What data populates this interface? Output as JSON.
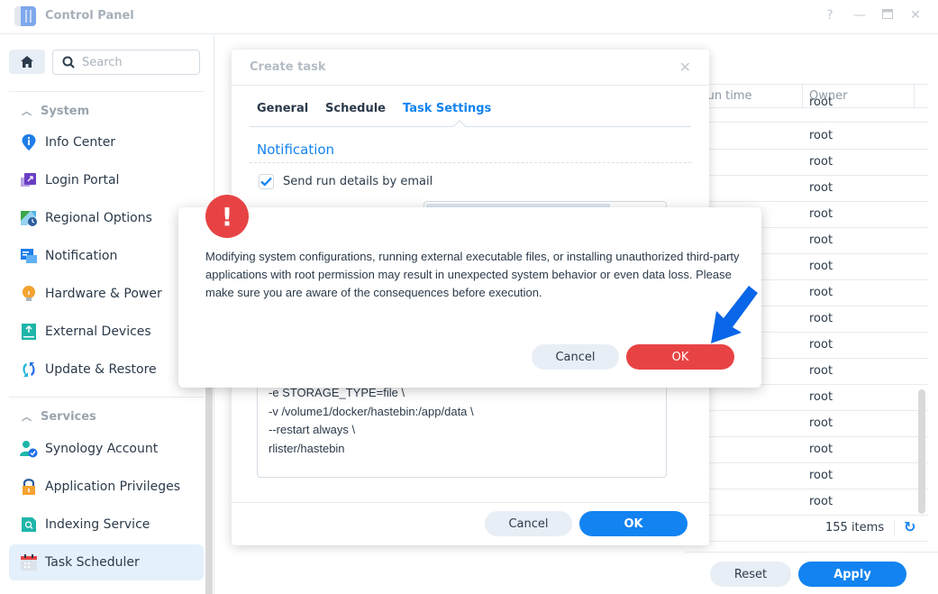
{
  "window": {
    "title": "Control Panel",
    "help_icon": "?",
    "minimize_icon": "—",
    "maximize_icon": "▭",
    "close_icon": "✕"
  },
  "sidebar": {
    "search_placeholder": "Search",
    "sections": [
      {
        "label": "System",
        "items": [
          {
            "label": "Info Center",
            "icon": "info-icon"
          },
          {
            "label": "Login Portal",
            "icon": "login-portal-icon"
          },
          {
            "label": "Regional Options",
            "icon": "regional-options-icon"
          },
          {
            "label": "Notification",
            "icon": "notification-icon"
          },
          {
            "label": "Hardware & Power",
            "icon": "lightbulb-icon"
          },
          {
            "label": "External Devices",
            "icon": "external-device-icon"
          },
          {
            "label": "Update & Restore",
            "icon": "update-icon"
          }
        ]
      },
      {
        "label": "Services",
        "items": [
          {
            "label": "Synology Account",
            "icon": "account-icon"
          },
          {
            "label": "Application Privileges",
            "icon": "lock-icon"
          },
          {
            "label": "Indexing Service",
            "icon": "indexing-icon"
          },
          {
            "label": "Task Scheduler",
            "icon": "calendar-icon",
            "active": true
          }
        ]
      }
    ]
  },
  "grid": {
    "columns": [
      "Next run time",
      "Owner"
    ],
    "visible_header_fragment": "t run time",
    "rows": [
      "root",
      "root",
      "root",
      "root",
      "root",
      "root",
      "root",
      "root",
      "root",
      "root",
      "root",
      "root",
      "root",
      "root",
      "root",
      "root"
    ],
    "items_count": "155 items",
    "refresh_icon": "↻"
  },
  "footer": {
    "reset_label": "Reset",
    "apply_label": "Apply"
  },
  "create_task_dialog": {
    "title": "Create task",
    "close_icon": "✕",
    "tabs": [
      {
        "label": "General"
      },
      {
        "label": "Schedule"
      },
      {
        "label": "Task Settings",
        "active": true
      }
    ],
    "section_title": "Notification",
    "send_email_label": "Send run details by email",
    "send_email_checked": true,
    "script_lines": [
      "-e STORAGE_TYPE=file \\",
      "-v /volume1/docker/hastebin:/app/data \\",
      "--restart always \\",
      "rlister/hastebin"
    ],
    "cancel_label": "Cancel",
    "ok_label": "OK"
  },
  "warning_dialog": {
    "icon": "!",
    "message": "Modifying system configurations, running external executable files, or installing unauthorized third-party applications with root permission may result in unexpected system behavior or even data loss. Please make sure you are aware of the consequences before execution.",
    "cancel_label": "Cancel",
    "ok_label": "OK"
  },
  "colors": {
    "accent": "#1283f0",
    "danger": "#e84344",
    "annotation_arrow": "#0a66e8"
  }
}
